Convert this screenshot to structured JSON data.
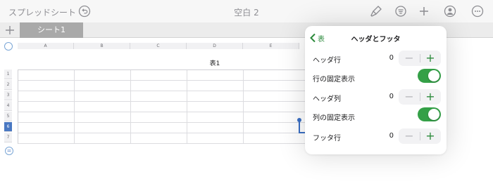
{
  "app": {
    "title": "スプレッドシート",
    "document_title": "空白 2"
  },
  "toolbar": {
    "icons": [
      "undo-icon",
      "format-brush-icon",
      "view-options-icon",
      "add-icon",
      "collaborate-icon",
      "more-icon"
    ],
    "accent_color": "#2c8a3c"
  },
  "sheets": {
    "active_tab": "シート1"
  },
  "table": {
    "title": "表1",
    "columns": [
      "A",
      "B",
      "C",
      "D",
      "E"
    ],
    "rows": [
      "1",
      "2",
      "3",
      "4",
      "5",
      "6",
      "7"
    ],
    "selected_row": "6"
  },
  "popover": {
    "back_label": "表",
    "title": "ヘッダとフッタ",
    "rows": [
      {
        "label": "ヘッダ行",
        "type": "stepper",
        "value": "0"
      },
      {
        "label": "行の固定表示",
        "type": "toggle",
        "on": true
      },
      {
        "label": "ヘッダ列",
        "type": "stepper",
        "value": "0"
      },
      {
        "label": "列の固定表示",
        "type": "toggle",
        "on": true
      },
      {
        "label": "フッタ行",
        "type": "stepper",
        "value": "0"
      }
    ],
    "minus_symbol": "−",
    "plus_symbol": "+"
  }
}
